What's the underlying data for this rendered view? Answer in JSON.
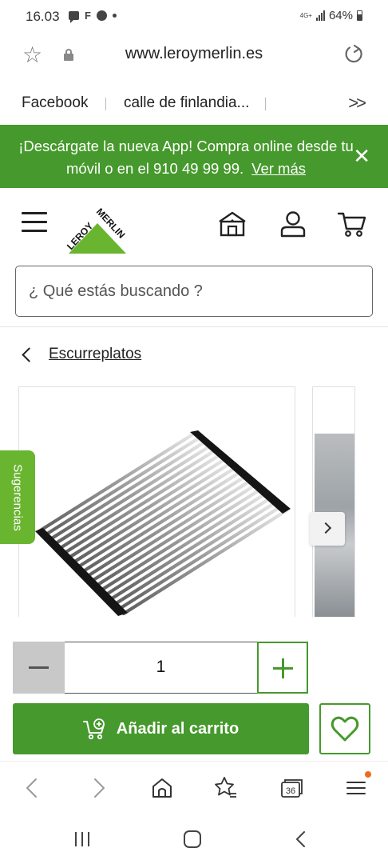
{
  "status_bar": {
    "time": "16.03",
    "notif_letter": "F",
    "network": "4G+",
    "battery": "64%"
  },
  "browser": {
    "url": "www.leroymerlin.es",
    "bookmarks": [
      "Facebook",
      "calle de finlandia..."
    ],
    "bookmarks_more": ">>",
    "tab_count": "36"
  },
  "promo": {
    "text": "¡Descárgate la nueva App! Compra online desde tu móvil o en el 910 49 99 99.",
    "link": "Ver más"
  },
  "header": {
    "logo_text_1": "LEROY",
    "logo_text_2": "MERLIN"
  },
  "search": {
    "placeholder": "¿ Qué estás buscando ?"
  },
  "breadcrumb": {
    "label": "Escurreplatos"
  },
  "side_tab": {
    "label": "Sugerencias"
  },
  "quantity": {
    "value": "1"
  },
  "cart": {
    "label": "Añadir al carrito"
  },
  "colors": {
    "brand_green": "#46992c",
    "tab_green": "#6ab530",
    "notif_orange": "#f06a1a"
  }
}
